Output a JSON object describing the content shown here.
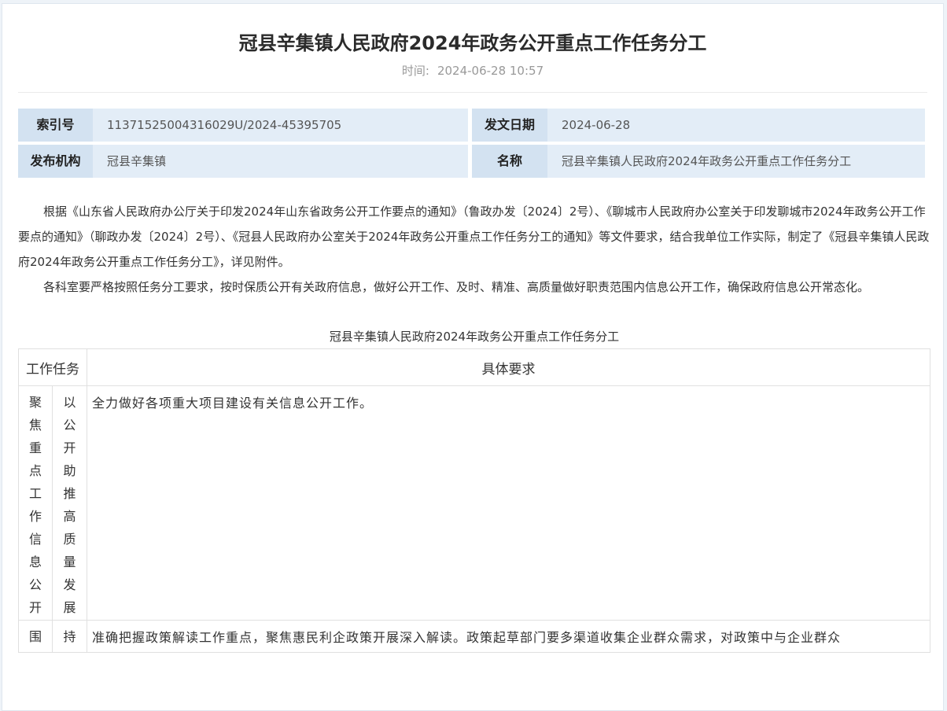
{
  "article": {
    "title": "冠县辛集镇人民政府2024年政务公开重点工作任务分工",
    "time_label": "时间:",
    "time_value": "2024-06-28 10:57"
  },
  "meta": {
    "index_label": "索引号",
    "index_value": "11371525004316029U/2024-45395705",
    "date_label": "发文日期",
    "date_value": "2024-06-28",
    "org_label": "发布机构",
    "org_value": "冠县辛集镇",
    "name_label": "名称",
    "name_value": "冠县辛集镇人民政府2024年政务公开重点工作任务分工"
  },
  "body": {
    "p1": "根据《山东省人民政府办公厅关于印发2024年山东省政务公开工作要点的通知》（鲁政办发〔2024〕2号）、《聊城市人民政府办公室关于印发聊城市2024年政务公开工作要点的通知》（聊政办发〔2024〕2号）、《冠县人民政府办公室关于2024年政务公开重点工作任务分工的通知》等文件要求，结合我单位工作实际，制定了《冠县辛集镇人民政府2024年政务公开重点工作任务分工》，详见附件。",
    "p2": "各科室要严格按照任务分工要求，按时保质公开有关政府信息，做好公开工作、及时、精准、高质量做好职责范围内信息公开工作，确保政府信息公开常态化。"
  },
  "table": {
    "caption": "冠县辛集镇人民政府2024年政务公开重点工作任务分工",
    "header_task": "工作任务",
    "header_req": "具体要求",
    "rows": [
      {
        "col1": [
          "聚",
          "焦",
          "重",
          "点",
          "工",
          "作",
          "信",
          "息",
          "公",
          "开"
        ],
        "col2": [
          "以",
          "公",
          "开",
          "助",
          "推",
          "高",
          "质",
          "量",
          "发",
          "展"
        ],
        "requirement": "全力做好各项重大项目建设有关信息公开工作。"
      },
      {
        "col1": [
          "围"
        ],
        "col2": [
          "持"
        ],
        "requirement": "准确把握政策解读工作重点，聚焦惠民利企政策开展深入解读。政策起草部门要多渠道收集企业群众需求，对政策中与企业群众"
      }
    ]
  }
}
